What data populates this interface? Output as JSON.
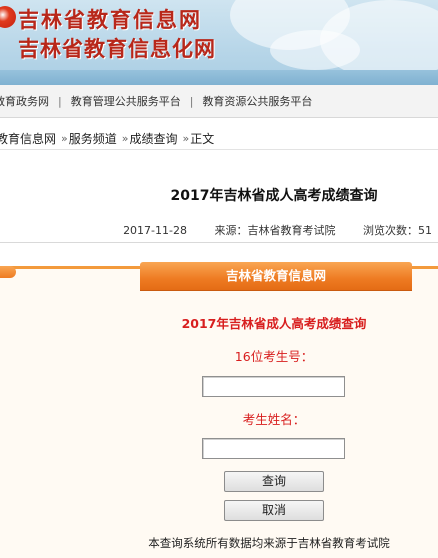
{
  "banner": {
    "line1": "吉林省教育信息网",
    "line2": "吉林省教育信息化网"
  },
  "topnav": {
    "items": [
      "教育政务网",
      "教育管理公共服务平台",
      "教育资源公共服务平台"
    ],
    "separator": "|"
  },
  "breadcrumb": {
    "items": [
      "教育信息网",
      "服务频道",
      "成绩查询",
      "正文"
    ],
    "arrow": "»"
  },
  "article": {
    "title": "2017年吉林省成人高考成绩查询",
    "date": "2017-11-28",
    "source": "来源：吉林省教育考试院",
    "views": "浏览次数：51"
  },
  "query": {
    "panel_title": "吉林省教育信息网",
    "form_title": "2017年吉林省成人高考成绩查询",
    "id_label": "16位考生号：",
    "id_value": "",
    "name_label": "考生姓名：",
    "name_value": "",
    "submit_label": "查询",
    "cancel_label": "取消",
    "footnote": "本查询系统所有数据均来源于吉林省教育考试院"
  },
  "colors": {
    "brand_red": "#b8271a",
    "accent_orange": "#ee7b22",
    "form_red": "#d81e1e"
  }
}
